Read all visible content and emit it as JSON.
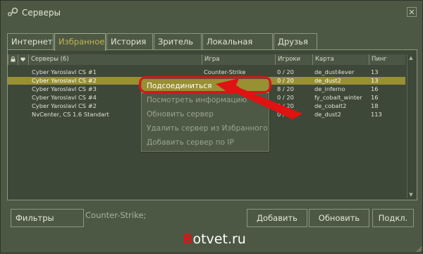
{
  "window": {
    "title": "Серверы",
    "close": "✕"
  },
  "tabs": [
    "Интернет",
    "Избранное",
    "История",
    "Зритель",
    "Локальная сеть",
    "Друзья"
  ],
  "active_tab": 1,
  "table": {
    "columns": [
      "Серверы (6)",
      "Игра",
      "Игроки",
      "Карта",
      "Пинг"
    ],
    "rows": [
      {
        "name": "Cyber Yaroslavl CS #1",
        "game": "Counter-Strike",
        "players": "0 / 20",
        "map": "de_dust4ever",
        "ping": "13"
      },
      {
        "name": "Cyber Yaroslavl CS #2",
        "game": "",
        "players": "0 / 20",
        "map": "de_dust2",
        "ping": "13"
      },
      {
        "name": "Cyber Yaroslavl CS #3",
        "game": "",
        "players": "8 / 20",
        "map": "de_inferno",
        "ping": "16"
      },
      {
        "name": "Cyber Yaroslavl CS #4",
        "game": "",
        "players": "0 / 20",
        "map": "fy_cobalt_winter",
        "ping": "16"
      },
      {
        "name": "Cyber Yaroslavl CS #2",
        "game": "",
        "players": "0 / 20",
        "map": "de_cobalt2",
        "ping": "18"
      },
      {
        "name": "NvCenter, CS 1.6 Standart",
        "game": "",
        "players": "0 / 16",
        "map": "de_dust2",
        "ping": "113"
      }
    ],
    "selected_row": 1
  },
  "context_menu": [
    "Подсоединиться",
    "Посмотреть информацию",
    "Обновить сервер",
    "Удалить сервер из Избранного",
    "Добавить сервер по IP"
  ],
  "footer": {
    "filters": "Фильтры",
    "filter_text": "Counter-Strike;",
    "add": "Добавить",
    "refresh": "Обновить",
    "connect": "Подкл."
  },
  "watermark": {
    "first": "B",
    "rest": "otvet.ru"
  },
  "colors": {
    "selection": "#998f33",
    "annotation": "#e01212",
    "active_tab_text": "#c4b550"
  }
}
